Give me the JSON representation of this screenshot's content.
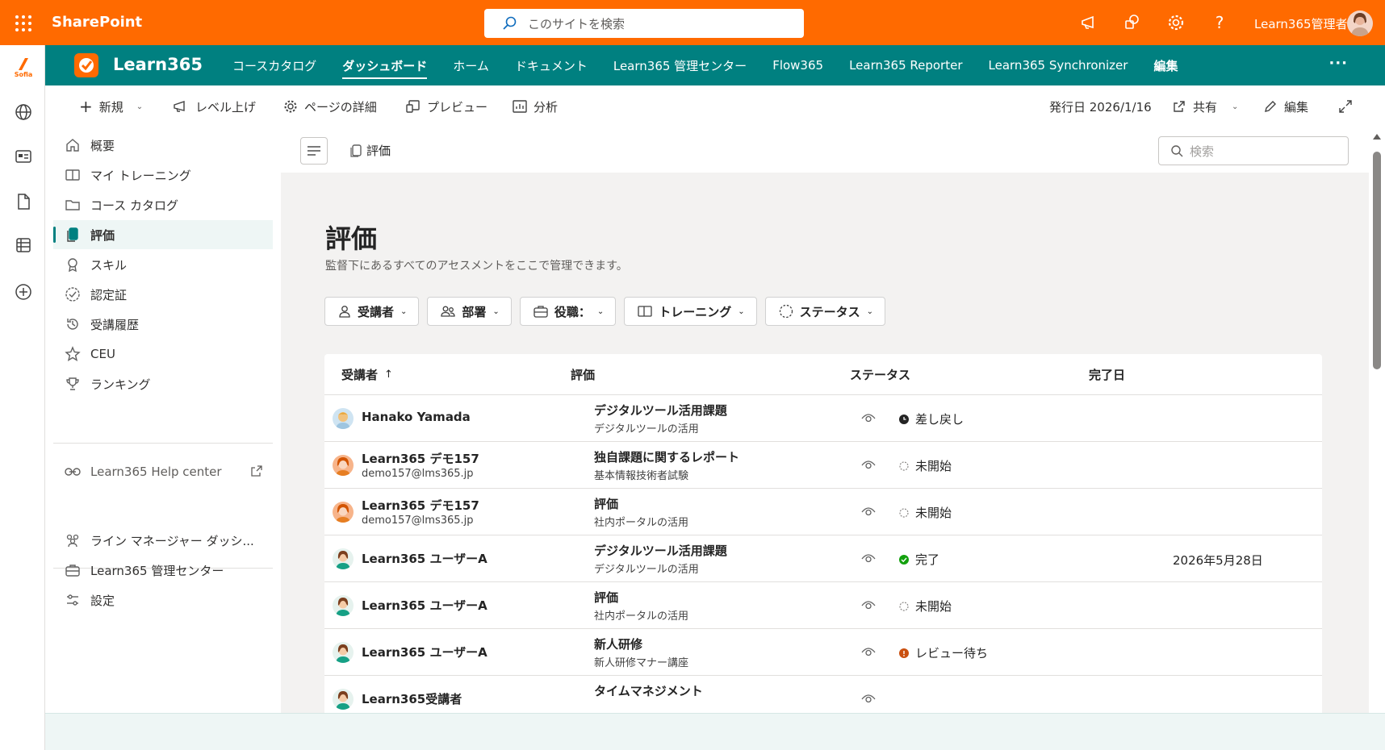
{
  "suite": {
    "app_name": "SharePoint",
    "search_placeholder": "このサイトを検索",
    "user_name": "Learn365管理者"
  },
  "appbar": {
    "sofia_label": "Sofia"
  },
  "hub": {
    "site_title": "Learn365",
    "links": [
      "コースカタログ",
      "ダッシュボード",
      "ホーム",
      "ドキュメント",
      "Learn365 管理センター",
      "Flow365",
      "Learn365 Reporter",
      "Learn365 Synchronizer",
      "編集"
    ],
    "active_link": "ダッシュボード",
    "more": "···"
  },
  "commandbar": {
    "new": "新規",
    "level_up": "レベル上げ",
    "page_details": "ページの詳細",
    "preview": "プレビュー",
    "analytics": "分析",
    "published": "発行日 2026/1/16",
    "share": "共有",
    "edit": "編集"
  },
  "sidenav": {
    "items": [
      {
        "label": "概要",
        "icon": "home-icon"
      },
      {
        "label": "マイ トレーニング",
        "icon": "book-icon"
      },
      {
        "label": "コース カタログ",
        "icon": "folder-icon"
      },
      {
        "label": "評価",
        "icon": "assessment-icon",
        "selected": true
      },
      {
        "label": "スキル",
        "icon": "ribbon-icon"
      },
      {
        "label": "認定証",
        "icon": "certificate-icon"
      },
      {
        "label": "受講履歴",
        "icon": "history-icon"
      },
      {
        "label": "CEU",
        "icon": "star-icon"
      },
      {
        "label": "ランキング",
        "icon": "trophy-icon"
      }
    ],
    "help_center": "Learn365 Help center",
    "bottom_items": [
      {
        "label": "ライン マネージャー ダッシ...",
        "icon": "people-icon"
      },
      {
        "label": "Learn365 管理センター",
        "icon": "briefcase-icon"
      },
      {
        "label": "設定",
        "icon": "settings-icon"
      }
    ]
  },
  "main": {
    "breadcrumb": "評価",
    "search_placeholder": "検索",
    "title": "評価",
    "subtitle": "監督下にあるすべてのアセスメントをここで管理できます。",
    "filters": [
      "受講者",
      "部署",
      "役職：",
      "トレーニング",
      "ステータス"
    ],
    "columns": {
      "learner": "受講者",
      "assessment": "評価",
      "status": "ステータス",
      "completed": "完了日"
    },
    "rows": [
      {
        "name": "Hanako Yamada",
        "email": "",
        "assessment": "デジタルツール活用課題",
        "course": "デジタルツールの活用",
        "status": "差し戻し",
        "status_color": "#242424",
        "date": ""
      },
      {
        "name": "Learn365 デモ157",
        "email": "demo157@lms365.jp",
        "assessment": "独自課題に関するレポート",
        "course": "基本情報技術者試験",
        "status": "未開始",
        "status_color": "#8a8886",
        "date": ""
      },
      {
        "name": "Learn365 デモ157",
        "email": "demo157@lms365.jp",
        "assessment": "評価",
        "course": "社内ポータルの活用",
        "status": "未開始",
        "status_color": "#8a8886",
        "date": ""
      },
      {
        "name": "Learn365 ユーザーA",
        "email": "",
        "assessment": "デジタルツール活用課題",
        "course": "デジタルツールの活用",
        "status": "完了",
        "status_color": "#13a10e",
        "date": "2026年5月28日"
      },
      {
        "name": "Learn365 ユーザーA",
        "email": "",
        "assessment": "評価",
        "course": "社内ポータルの活用",
        "status": "未開始",
        "status_color": "#8a8886",
        "date": ""
      },
      {
        "name": "Learn365 ユーザーA",
        "email": "",
        "assessment": "新人研修",
        "course": "新人研修マナー講座",
        "status": "レビュー待ち",
        "status_color": "#ca5010",
        "date": ""
      },
      {
        "name": "Learn365受講者",
        "email": "",
        "assessment": "タイムマネジメント",
        "course": "",
        "status": "",
        "status_color": "#8a8886",
        "date": ""
      }
    ]
  },
  "colors": {
    "suite_orange": "#ff6a00",
    "teal": "#008080"
  }
}
